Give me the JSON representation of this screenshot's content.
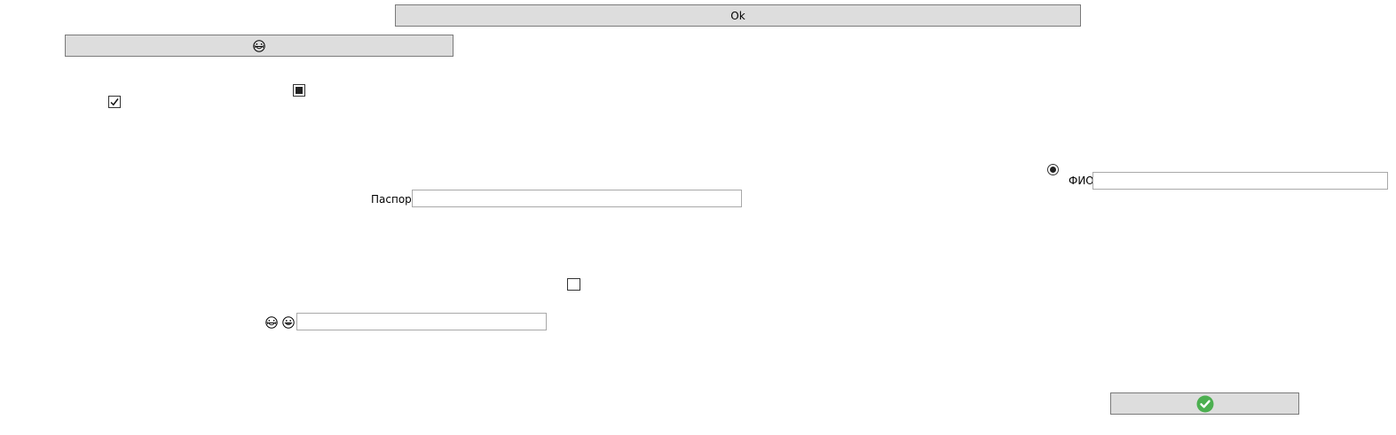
{
  "buttons": {
    "ok_label": "Ok",
    "emoji_button_icon": "laughing-face-icon",
    "confirm_button_icon": "green-checkmark-icon"
  },
  "checkboxes": {
    "top_left_checked": true,
    "indeterminate_square": true,
    "middle_unchecked": false
  },
  "radio": {
    "selected": true
  },
  "fields": {
    "fio_label": "ФИО",
    "fio_value": "",
    "passport_label": "Паспорт",
    "passport_value": "",
    "emoji_field_value": ""
  },
  "icons": {
    "emoji_1": "laughing-face-icon",
    "emoji_2": "grinning-face-icon"
  },
  "colors": {
    "button_bg": "#dddddd",
    "confirm_green": "#4caf50"
  }
}
